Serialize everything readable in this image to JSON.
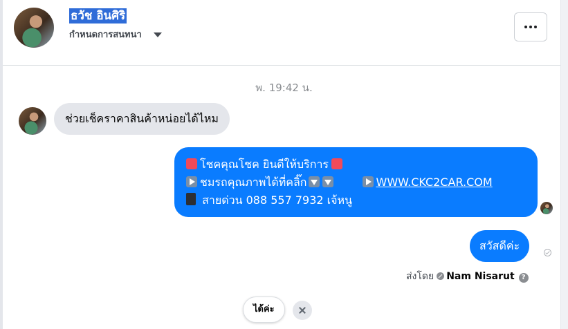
{
  "header": {
    "contact_name": "ธวัช อินศิริ",
    "theme_label": "กำหนดการสนทนา"
  },
  "conversation": {
    "timestamp": "พ. 19:42 น.",
    "incoming_message": "ช่วยเช็คราคาสินค้าหน่อยได้ไหม",
    "outgoing_message": {
      "line1": "โชคคุณโชค ยินดีให้บริการ",
      "line2_text": "ชมรถคุณภาพได้ที่คลิ๊ก",
      "line2_link": "WWW.CKC2CAR.COM",
      "line3": "สายด่วน 088 557 7932 เจ้หนู"
    },
    "reply_message": "สวัสดีค่ะ",
    "sent_by_label": "ส่งโดย",
    "sent_by_name": "Nam Nisarut",
    "help_mark": "?"
  },
  "quick_reply": {
    "label": "ได้ค่ะ"
  },
  "colors": {
    "outgoing_bubble": "#0a7cff",
    "incoming_bubble": "#e4e6eb",
    "name_highlight": "#2f6cd8"
  }
}
